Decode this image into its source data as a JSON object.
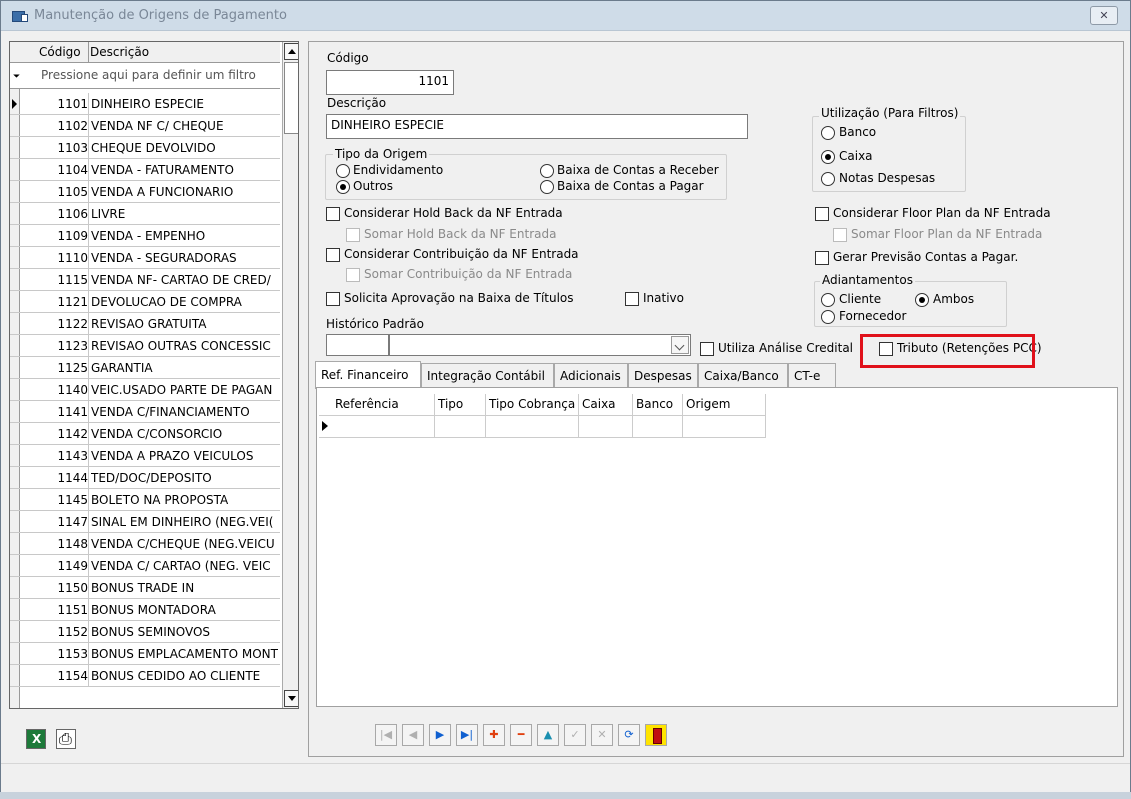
{
  "window": {
    "title": "Manutenção de Origens de Pagamento",
    "close_label": "✕"
  },
  "list": {
    "col_code": "Código",
    "col_desc": "Descrição",
    "filter_placeholder": "Pressione aqui para definir um filtro",
    "rows": [
      {
        "code": "1101",
        "desc": "DINHEIRO ESPECIE"
      },
      {
        "code": "1102",
        "desc": "VENDA NF C/ CHEQUE"
      },
      {
        "code": "1103",
        "desc": "CHEQUE DEVOLVIDO"
      },
      {
        "code": "1104",
        "desc": "VENDA - FATURAMENTO"
      },
      {
        "code": "1105",
        "desc": "VENDA A FUNCIONARIO"
      },
      {
        "code": "1106",
        "desc": "LIVRE"
      },
      {
        "code": "1109",
        "desc": "VENDA - EMPENHO"
      },
      {
        "code": "1110",
        "desc": "VENDA - SEGURADORAS"
      },
      {
        "code": "1115",
        "desc": "VENDA NF- CARTAO DE CRED/"
      },
      {
        "code": "1121",
        "desc": "DEVOLUCAO DE COMPRA"
      },
      {
        "code": "1122",
        "desc": "REVISAO GRATUITA"
      },
      {
        "code": "1123",
        "desc": "REVISAO OUTRAS CONCESSIC"
      },
      {
        "code": "1125",
        "desc": "GARANTIA"
      },
      {
        "code": "1140",
        "desc": "VEIC.USADO PARTE DE PAGAN"
      },
      {
        "code": "1141",
        "desc": "VENDA C/FINANCIAMENTO"
      },
      {
        "code": "1142",
        "desc": "VENDA C/CONSORCIO"
      },
      {
        "code": "1143",
        "desc": "VENDA A PRAZO VEICULOS"
      },
      {
        "code": "1144",
        "desc": "TED/DOC/DEPOSITO"
      },
      {
        "code": "1145",
        "desc": "BOLETO NA PROPOSTA"
      },
      {
        "code": "1147",
        "desc": "SINAL EM DINHEIRO (NEG.VEI("
      },
      {
        "code": "1148",
        "desc": "VENDA C/CHEQUE (NEG.VEICU"
      },
      {
        "code": "1149",
        "desc": "VENDA C/ CARTAO (NEG. VEIC"
      },
      {
        "code": "1150",
        "desc": "BONUS TRADE IN"
      },
      {
        "code": "1151",
        "desc": "BONUS MONTADORA"
      },
      {
        "code": "1152",
        "desc": "BONUS SEMINOVOS"
      },
      {
        "code": "1153",
        "desc": "BONUS EMPLACAMENTO MONT"
      },
      {
        "code": "1154",
        "desc": "BONUS CEDIDO AO CLIENTE"
      }
    ]
  },
  "form": {
    "codigo_label": "Código",
    "codigo_value": "1101",
    "descricao_label": "Descrição",
    "descricao_value": "DINHEIRO ESPECIE",
    "tipo_origem": {
      "legend": "Tipo da Origem",
      "endividamento": "Endividamento",
      "outros": "Outros",
      "baixa_receber": "Baixa de Contas a Receber",
      "baixa_pagar": "Baixa de Contas a Pagar",
      "selected": "Outros"
    },
    "utilizacao": {
      "legend": "Utilização (Para Filtros)",
      "banco": "Banco",
      "caixa": "Caixa",
      "notas": "Notas Despesas",
      "selected": "Caixa"
    },
    "hold_back": "Considerar Hold Back da NF Entrada",
    "somar_hold_back": "Somar Hold Back da NF Entrada",
    "contribuicao": "Considerar Contribuição da NF Entrada",
    "somar_contribuicao": "Somar Contribuição da NF Entrada",
    "solicita_aprovacao": "Solicita Aprovação na Baixa de Títulos",
    "inativo": "Inativo",
    "floor_plan": "Considerar Floor Plan da NF Entrada",
    "somar_floor_plan": "Somar Floor Plan da NF Entrada",
    "gerar_previsao": "Gerar Previsão Contas a Pagar.",
    "adiantamentos": {
      "legend": "Adiantamentos",
      "cliente": "Cliente",
      "ambos": "Ambos",
      "fornecedor": "Fornecedor",
      "selected": "Ambos"
    },
    "historico_label": "Histórico Padrão",
    "utiliza_analise": "Utiliza Análise Credital",
    "tributo": "Tributo (Retenções PCC)"
  },
  "tabs": [
    "Ref. Financeiro",
    "Integração Contábil",
    "Adicionais",
    "Despesas",
    "Caixa/Banco",
    "CT-e"
  ],
  "ref_grid": {
    "columns": [
      "Referência",
      "Tipo",
      "Tipo Cobrança",
      "Caixa",
      "Banco",
      "Origem"
    ]
  },
  "nav_buttons": [
    {
      "name": "first-record-button",
      "glyph": "|◀",
      "style": "dis"
    },
    {
      "name": "prev-record-button",
      "glyph": "◀",
      "style": "dis"
    },
    {
      "name": "next-record-button",
      "glyph": "▶",
      "style": "blue"
    },
    {
      "name": "last-record-button",
      "glyph": "▶|",
      "style": "blue"
    },
    {
      "name": "insert-button",
      "glyph": "✚",
      "style": "red"
    },
    {
      "name": "delete-button",
      "glyph": "━",
      "style": "red"
    },
    {
      "name": "edit-button",
      "glyph": "▲",
      "style": "teal"
    },
    {
      "name": "post-button",
      "glyph": "✓",
      "style": "dis"
    },
    {
      "name": "cancel-button",
      "glyph": "✕",
      "style": "dis"
    },
    {
      "name": "refresh-button",
      "glyph": "⟳",
      "style": "blue"
    },
    {
      "name": "exit-button",
      "glyph": "",
      "style": "exit"
    }
  ],
  "colors": {
    "highlight": "#e0101a"
  }
}
